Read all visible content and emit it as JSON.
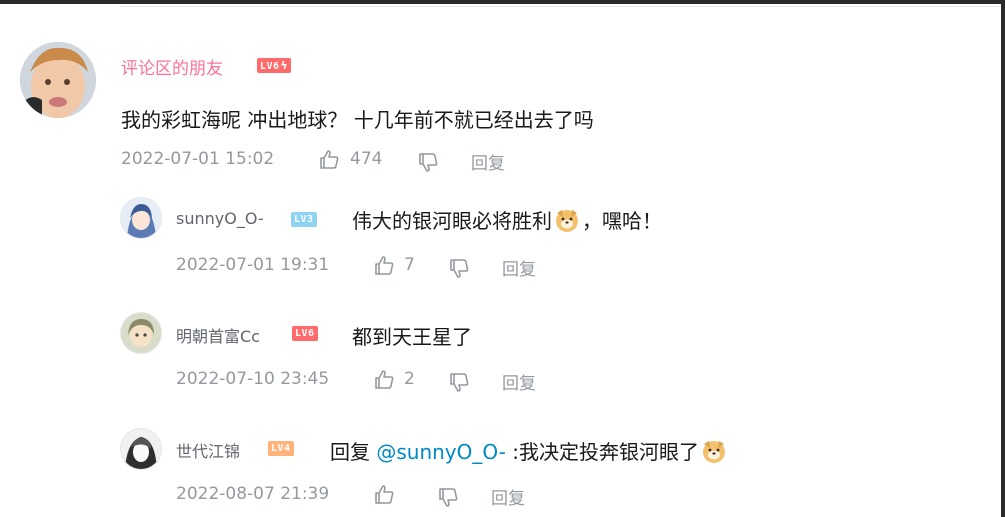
{
  "main": {
    "username": "评论区的朋友",
    "level": "LV6",
    "content": "我的彩虹海呢 冲出地球？ 十几年前不就已经出去了吗",
    "date": "2022-07-01 15:02",
    "likes": "474",
    "reply_label": "回复"
  },
  "replies": [
    {
      "username": "sunnyO_O-",
      "level": "LV3",
      "content_before": "伟大的银河眼必将胜利",
      "content_after": "，嘿哈！",
      "date": "2022-07-01 19:31",
      "likes": "7",
      "reply_label": "回复"
    },
    {
      "username": "明朝首富Cc",
      "level": "LV6",
      "content": "都到天王星了",
      "date": "2022-07-10 23:45",
      "likes": "2",
      "reply_label": "回复"
    },
    {
      "username": "世代江锦",
      "level": "LV4",
      "reply_prefix": "回复",
      "mention": "@sunnyO_O-",
      "content": ":我决定投奔银河眼了",
      "date": "2022-08-07 21:39",
      "likes": "",
      "reply_label": "回复"
    }
  ],
  "colors": {
    "username_vip": "#fb7299",
    "username": "#61666d",
    "meta": "#9499a0",
    "mention": "#008ac5"
  },
  "icons": [
    "like-icon",
    "dislike-icon",
    "emoji-dog-icon"
  ]
}
